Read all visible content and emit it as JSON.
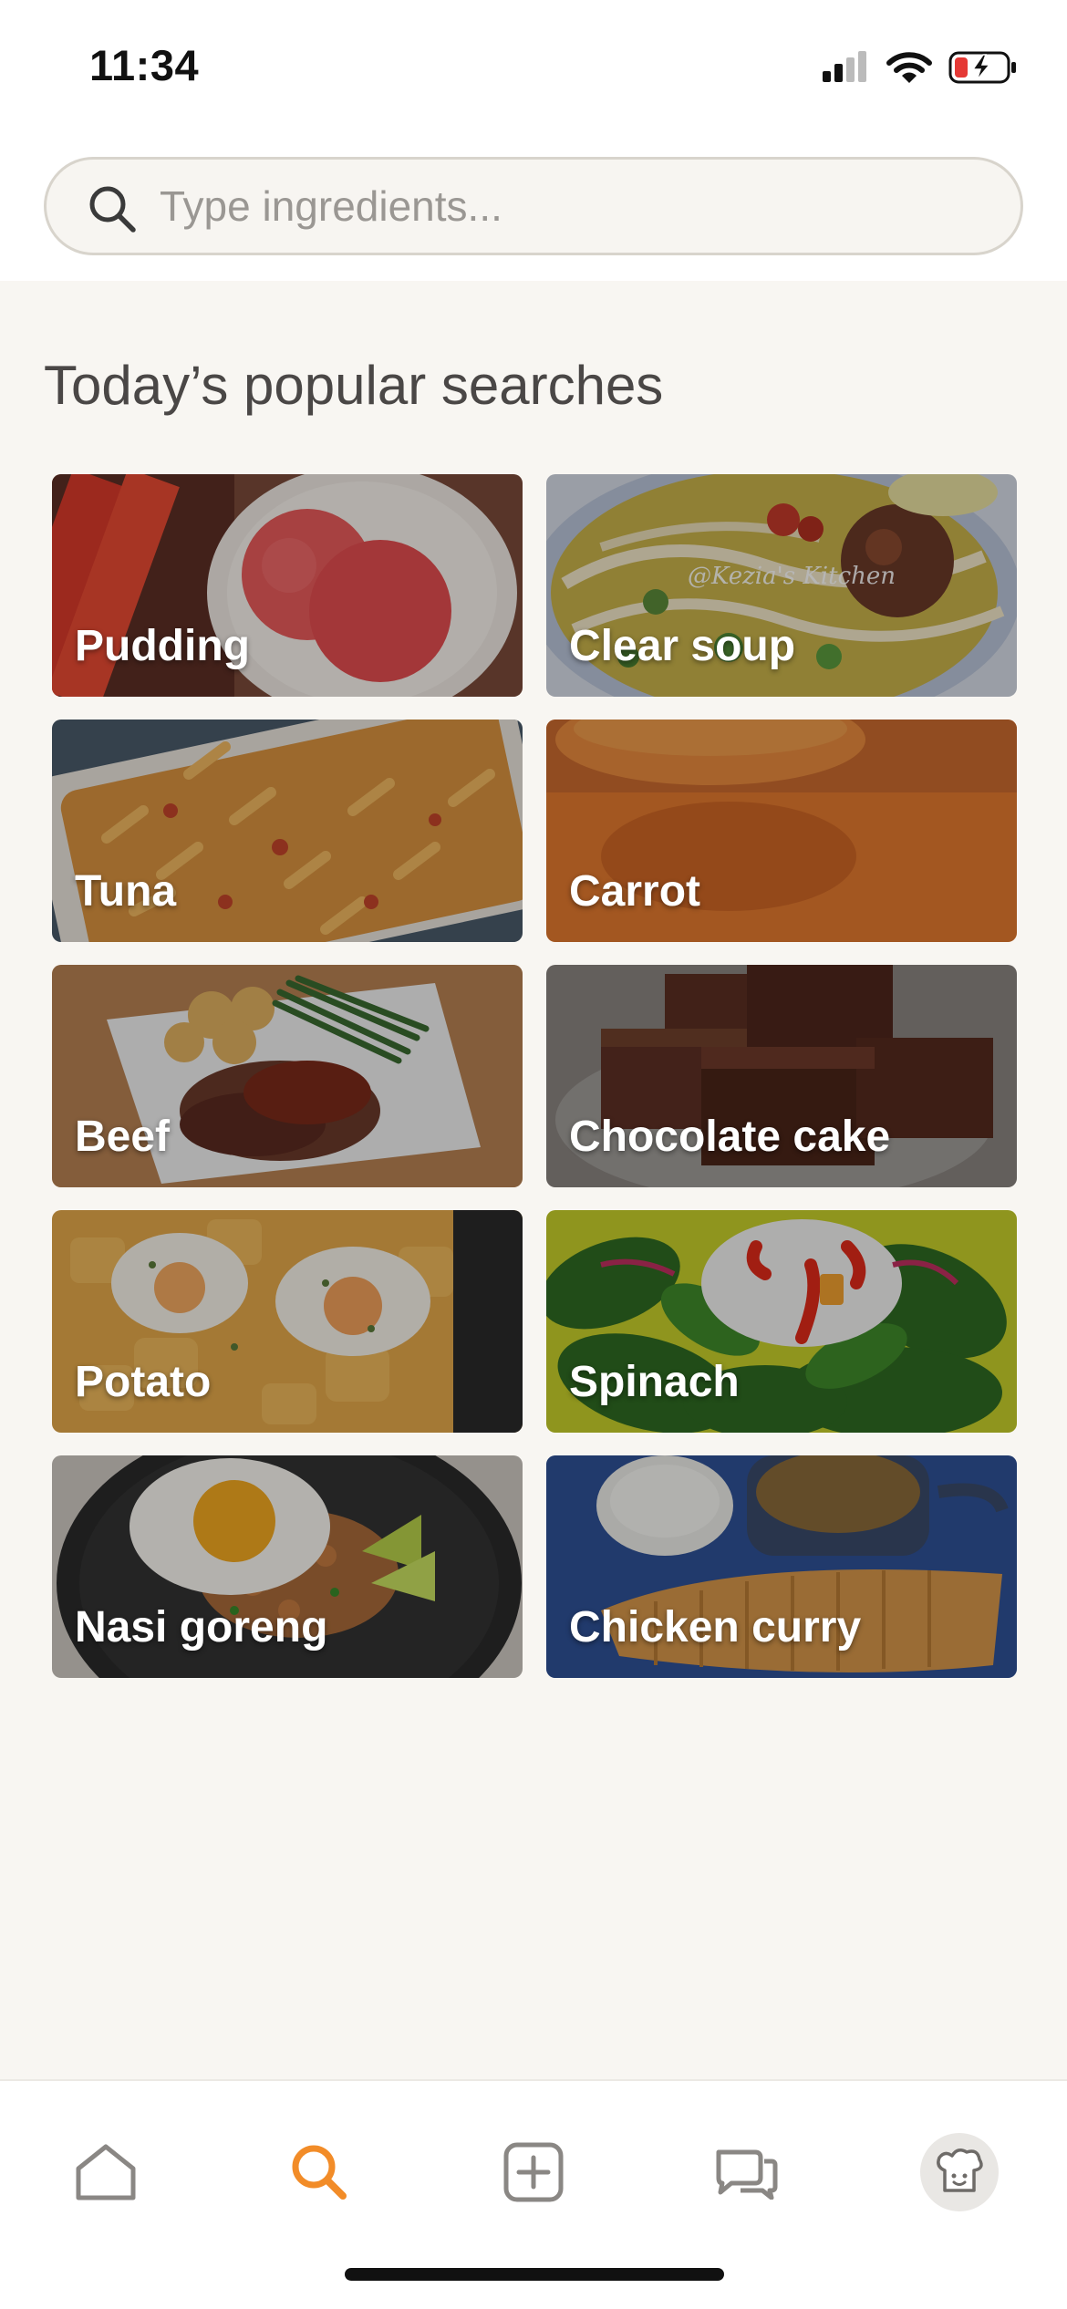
{
  "status_bar": {
    "time": "11:34"
  },
  "search": {
    "placeholder": "Type ingredients..."
  },
  "section_title": "Today’s popular searches",
  "tiles": [
    {
      "label": "Pudding",
      "theme": "pudding"
    },
    {
      "label": "Clear soup",
      "theme": "soup"
    },
    {
      "label": "Tuna",
      "theme": "tuna"
    },
    {
      "label": "Carrot",
      "theme": "carrot"
    },
    {
      "label": "Beef",
      "theme": "beef"
    },
    {
      "label": "Chocolate cake",
      "theme": "choc"
    },
    {
      "label": "Potato",
      "theme": "potato"
    },
    {
      "label": "Spinach",
      "theme": "spinach"
    },
    {
      "label": "Nasi goreng",
      "theme": "nasi"
    },
    {
      "label": "Chicken curry",
      "theme": "curry"
    }
  ],
  "tile_watermark": "@Kezia's Kitchen",
  "tabbar": {
    "items": [
      {
        "icon": "home-icon",
        "active": false
      },
      {
        "icon": "search-icon",
        "active": true
      },
      {
        "icon": "add-recipe-icon",
        "active": false
      },
      {
        "icon": "chat-icon",
        "active": false
      },
      {
        "icon": "profile-chef-icon",
        "active": false
      }
    ]
  },
  "colors": {
    "accent": "#f28c28",
    "icon_inactive": "#8a8784",
    "background": "#f8f6f2"
  }
}
